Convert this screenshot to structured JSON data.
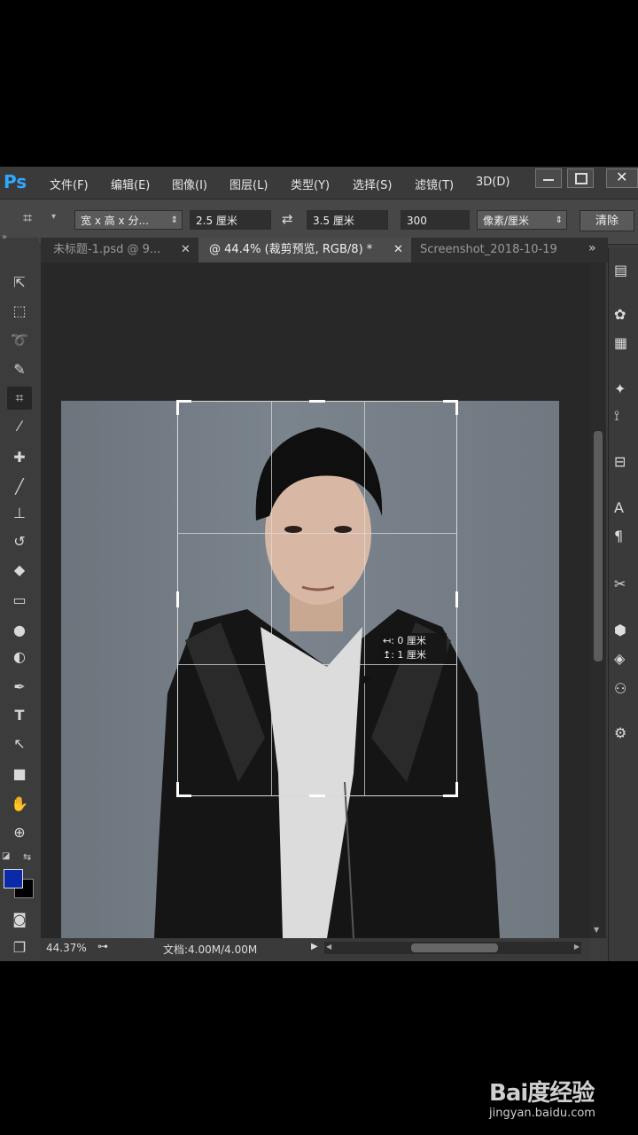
{
  "app": {
    "logo": "Ps"
  },
  "menu": [
    "文件(F)",
    "编辑(E)",
    "图像(I)",
    "图层(L)",
    "类型(Y)",
    "选择(S)",
    "滤镜(T)",
    "3D(D)"
  ],
  "options": {
    "ratio_preset": "宽 x 高 x 分...",
    "width": "2.5 厘米",
    "height": "3.5 厘米",
    "resolution": "300",
    "unit": "像素/厘米",
    "clear_button": "清除"
  },
  "tabs": [
    {
      "label": "未标题-1.psd @ 9...",
      "active": false
    },
    {
      "label": "@ 44.4% (裁剪预览, RGB/8) *",
      "active": true
    },
    {
      "label": "Screenshot_2018-10-19",
      "active": false
    }
  ],
  "tools": [
    "move-tool",
    "marquee-tool",
    "lasso-tool",
    "quick-select-tool",
    "crop-tool",
    "eyedropper-tool",
    "healing-brush-tool",
    "brush-tool",
    "clone-stamp-tool",
    "history-brush-tool",
    "eraser-tool",
    "gradient-tool",
    "blur-tool",
    "dodge-tool",
    "pen-tool",
    "type-tool",
    "path-select-tool",
    "rectangle-tool",
    "hand-tool",
    "zoom-tool"
  ],
  "colors": {
    "foreground": "#0a2aa8",
    "background": "#000000",
    "crop_tool_active": true
  },
  "crop_tooltip": {
    "line1": "↤: 0 厘米",
    "line2": "↥: 1 厘米"
  },
  "status": {
    "zoom": "44.37%",
    "doc": "文档:4.00M/4.00M"
  },
  "watermark": {
    "logo": "Bai度经验",
    "url": "jingyan.baidu.com"
  }
}
